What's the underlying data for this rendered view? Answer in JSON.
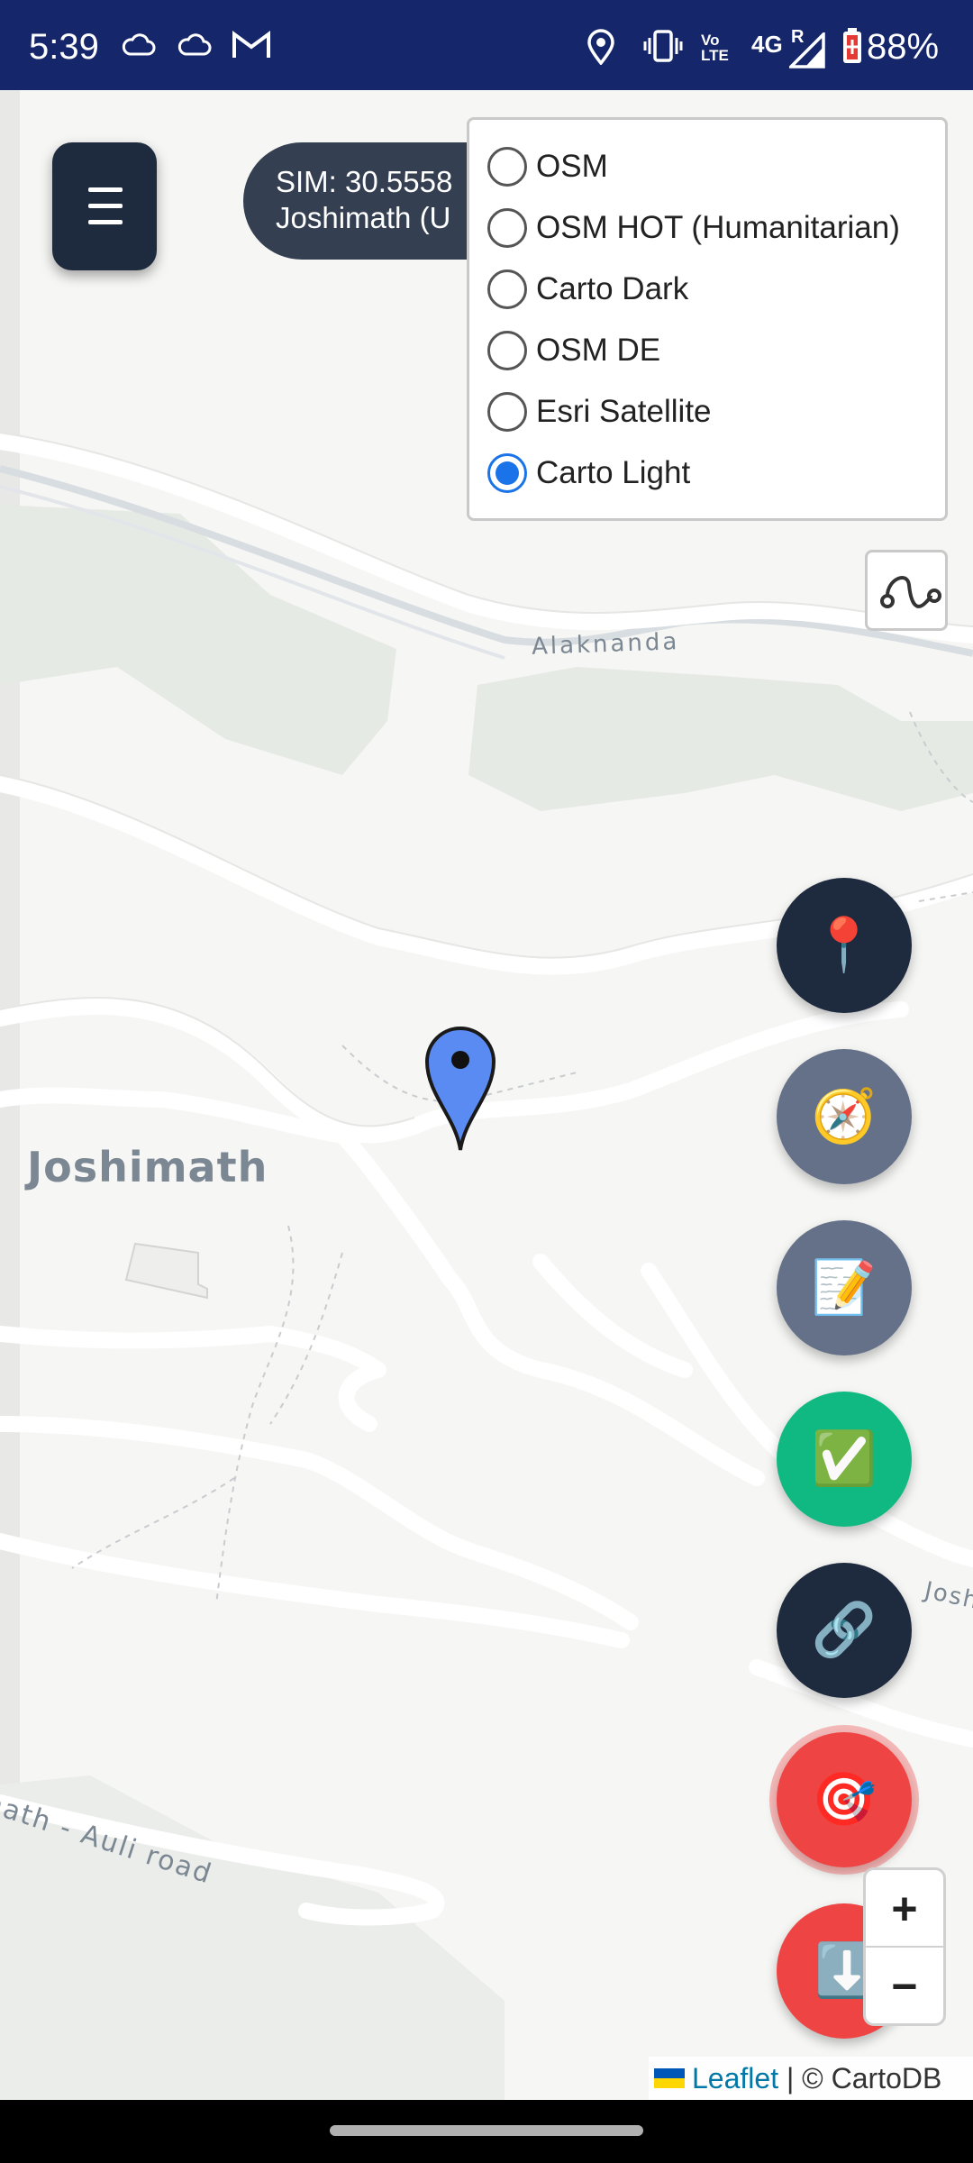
{
  "status_bar": {
    "time": "5:39",
    "battery": "88%",
    "network": "4G",
    "volte": "Vo LTE",
    "roaming": "R",
    "icons": [
      "cloud-icon",
      "cloud-icon",
      "gmail-icon",
      "location-icon",
      "vibrate-icon",
      "volte-icon",
      "signal-icon",
      "battery-icon"
    ]
  },
  "map": {
    "labels": {
      "town": "Joshimath",
      "river": "Alaknanda",
      "road": "math - Auli road",
      "edge_label": "Josh"
    }
  },
  "sim_info": {
    "line1": "SIM: 30.5558",
    "line2": "Joshimath (U"
  },
  "layers": {
    "options": [
      "OSM",
      "OSM HOT (Humanitarian)",
      "Carto Dark",
      "OSM DE",
      "Esri Satellite",
      "Carto Light"
    ],
    "selected": "Carto Light"
  },
  "fabs": [
    {
      "name": "pin-button",
      "icon": "📍",
      "color": "#1e2a3e"
    },
    {
      "name": "compass-button",
      "icon": "🧭",
      "color": "#647189"
    },
    {
      "name": "notes-button",
      "icon": "📝",
      "color": "#647189"
    },
    {
      "name": "check-button",
      "icon": "✅",
      "color": "#10b981"
    },
    {
      "name": "link-button",
      "icon": "🔗",
      "color": "#1e2a3e"
    },
    {
      "name": "target-button",
      "icon": "🎯",
      "color": "#ef4444"
    },
    {
      "name": "download-button",
      "icon": "⬇️",
      "color": "#ef4444"
    }
  ],
  "zoom": {
    "in": "+",
    "out": "−"
  },
  "attribution": {
    "leaflet": "Leaflet",
    "separator": " | ",
    "provider": "© CartoDB"
  }
}
